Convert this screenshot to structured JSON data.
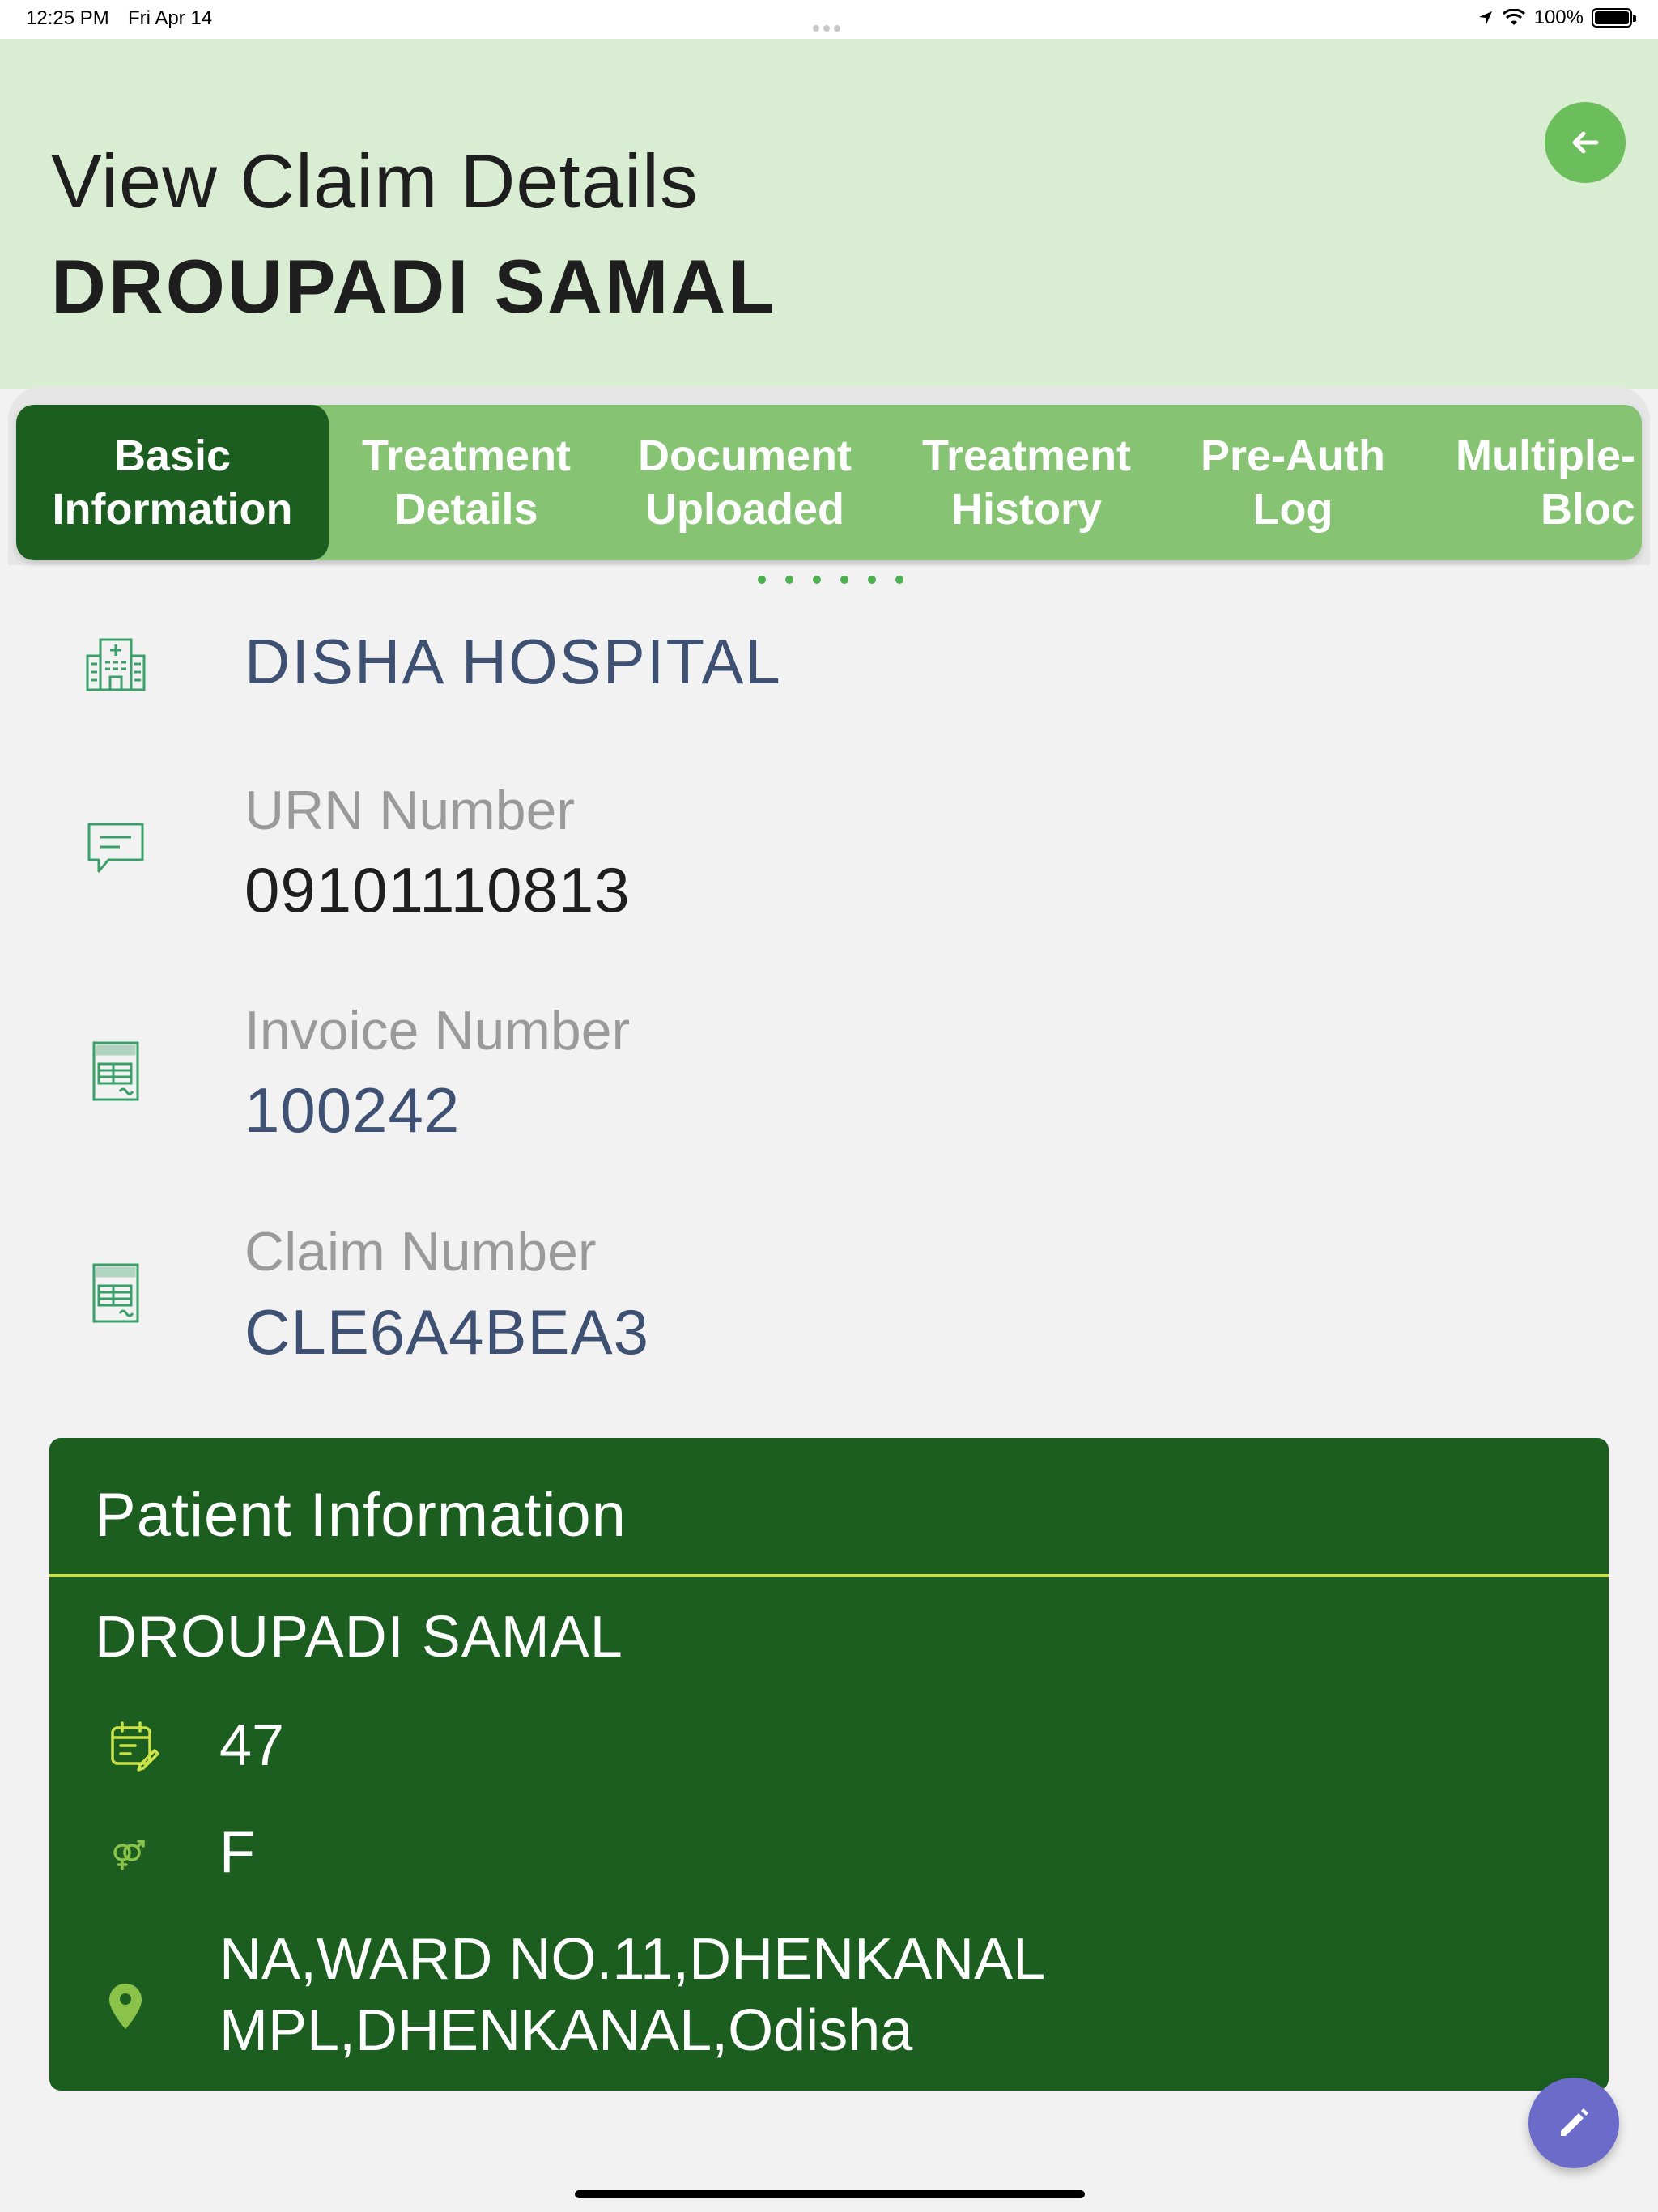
{
  "status_bar": {
    "time": "12:25 PM",
    "date": "Fri Apr 14",
    "battery": "100%"
  },
  "header": {
    "title": "View Claim Details",
    "patient_name": "DROUPADI SAMAL",
    "back_icon": "arrow-left-icon"
  },
  "tabs": [
    {
      "label": "Basic\nInformation",
      "active": true
    },
    {
      "label": "Treatment\nDetails",
      "active": false
    },
    {
      "label": "Document\nUploaded",
      "active": false
    },
    {
      "label": "Treatment\nHistory",
      "active": false
    },
    {
      "label": "Pre-Auth\nLog",
      "active": false
    },
    {
      "label": "Multiple-\nBloc",
      "active": false
    }
  ],
  "basic_info": {
    "hospital": "DISHA HOSPITAL",
    "urn": {
      "label": "URN Number",
      "value": "09101110813"
    },
    "invoice": {
      "label": "Invoice Number",
      "value": "100242"
    },
    "claim": {
      "label": "Claim Number",
      "value": "CLE6A4BEA3"
    }
  },
  "patient_card": {
    "title": "Patient Information",
    "name": "DROUPADI SAMAL",
    "age": "47",
    "gender": "F",
    "address": "NA,WARD NO.11,DHENKANAL\nMPL,DHENKANAL,Odisha"
  },
  "colors": {
    "header_bg": "#d8edd2",
    "tab_bg": "#86c373",
    "active_tab": "#1b5e20",
    "card_bg": "#1b5e20",
    "accent_yellow": "#cbe349",
    "fab": "#6b6bc9"
  }
}
